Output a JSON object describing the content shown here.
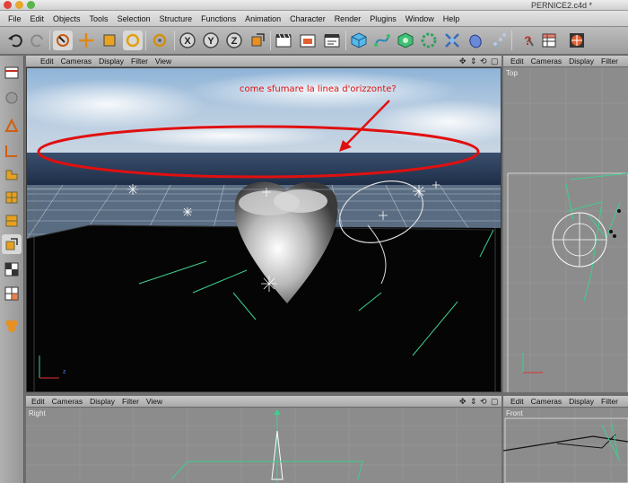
{
  "window": {
    "title": "PERNICE2.c4d *"
  },
  "menubar": [
    "File",
    "Edit",
    "Objects",
    "Tools",
    "Selection",
    "Structure",
    "Functions",
    "Animation",
    "Character",
    "Render",
    "Plugins",
    "Window",
    "Help"
  ],
  "viewport_menu": [
    "Edit",
    "Cameras",
    "Display",
    "Filter",
    "View"
  ],
  "right_viewport_menu": [
    "Edit",
    "Cameras",
    "Display",
    "Filter"
  ],
  "viewports": {
    "top_right_label": "Top",
    "bottom_left_label": "Right",
    "bottom_right_label": "Front"
  },
  "annotation": {
    "text": "come sfumare la linea d'orizzonte?",
    "color": "#e01010"
  },
  "colors": {
    "accent": "#e01010",
    "wire": "#3ecf8e"
  }
}
